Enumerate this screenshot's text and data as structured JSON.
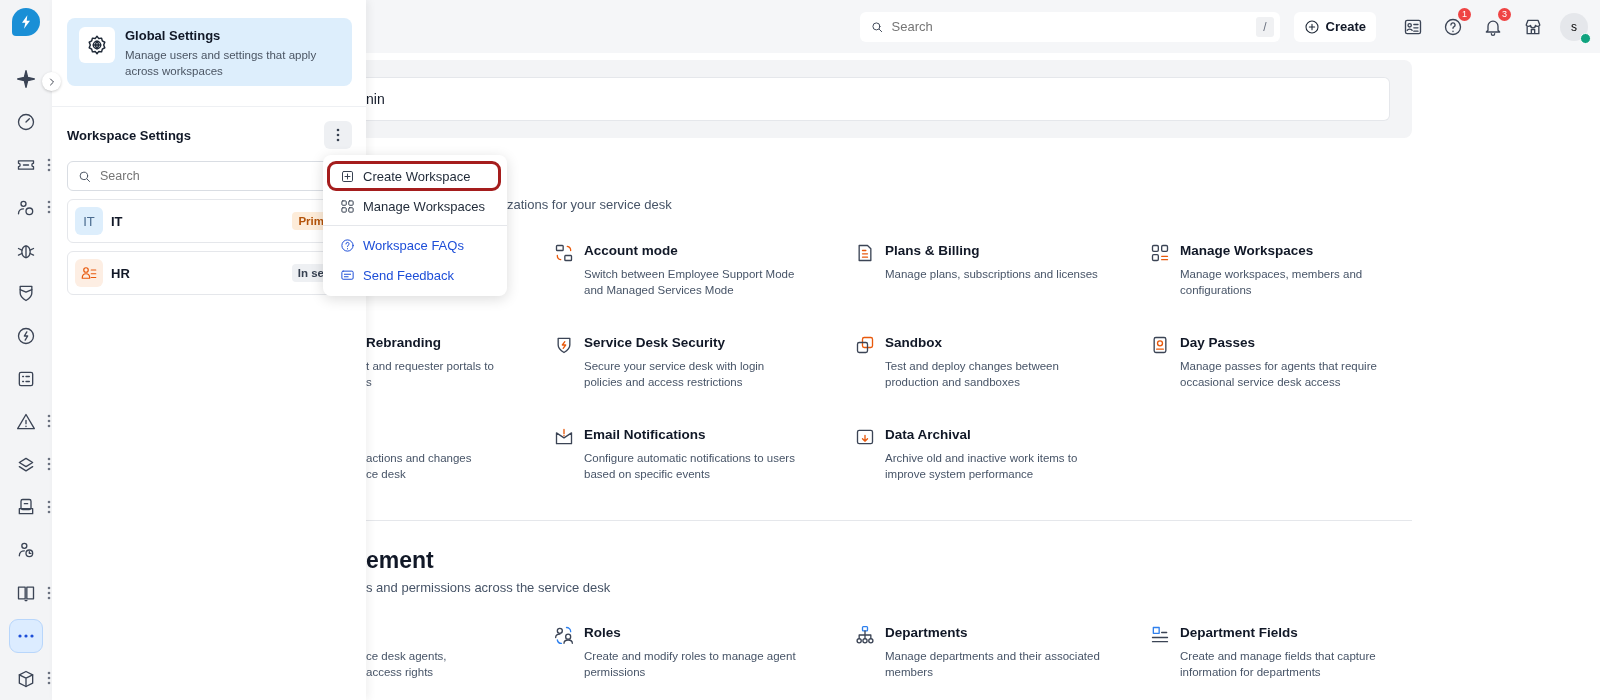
{
  "rail": {
    "items": [
      {
        "selected": false,
        "has_menu": false
      },
      {
        "selected": false,
        "has_menu": false
      },
      {
        "selected": false,
        "has_menu": true
      },
      {
        "selected": false,
        "has_menu": true
      },
      {
        "selected": false,
        "has_menu": false
      },
      {
        "selected": false,
        "has_menu": false
      },
      {
        "selected": false,
        "has_menu": false
      },
      {
        "selected": false,
        "has_menu": false
      },
      {
        "selected": false,
        "has_menu": true
      },
      {
        "selected": false,
        "has_menu": true
      },
      {
        "selected": false,
        "has_menu": true
      },
      {
        "selected": false,
        "has_menu": false
      },
      {
        "selected": false,
        "has_menu": true
      },
      {
        "selected": true,
        "has_menu": false
      },
      {
        "selected": false,
        "has_menu": true
      }
    ]
  },
  "panel": {
    "global": {
      "title": "Global Settings",
      "description": "Manage users and settings that apply across workspaces"
    },
    "workspace_title": "Workspace Settings",
    "search": {
      "placeholder": "Search"
    },
    "workspaces": [
      {
        "initials": "IT",
        "name": "IT",
        "badge": "Prim",
        "kind": "primary"
      },
      {
        "name": "HR",
        "badge": "In se",
        "kind": "setup"
      }
    ]
  },
  "menu": {
    "items": [
      {
        "label": "Create Workspace",
        "kind": "action",
        "highlighted": true
      },
      {
        "label": "Manage Workspaces",
        "kind": "action",
        "highlighted": false
      },
      {
        "label": "Workspace FAQs",
        "kind": "link",
        "highlighted": false
      },
      {
        "label": "Send Feedback",
        "kind": "link",
        "highlighted": false
      }
    ]
  },
  "header": {
    "search": {
      "placeholder": "Search",
      "shortcut": "/"
    },
    "create": "Create",
    "help_count": "1",
    "notification_count": "3",
    "avatar": "s",
    "online": true
  },
  "admin_search": {
    "value": "nin"
  },
  "sections": [
    {
      "subtitle": "zations for your service desk",
      "cards": [
        {
          "title": "Account mode",
          "lines": [
            "Switch between Employee Support Mode",
            "and Managed Services Mode"
          ]
        },
        {
          "title": "Plans & Billing",
          "lines": [
            "Manage plans, subscriptions and licenses"
          ]
        },
        {
          "title": "Manage Workspaces",
          "lines": [
            "Manage workspaces, members and",
            "configurations"
          ]
        },
        {
          "title": "Rebranding",
          "lines": [
            "t and requester portals to",
            "s"
          ]
        },
        {
          "title": "Service Desk Security",
          "lines": [
            "Secure your service desk with login",
            "policies and access restrictions"
          ]
        },
        {
          "title": "Sandbox",
          "lines": [
            "Test and deploy changes between",
            "production and sandboxes"
          ]
        },
        {
          "title": "Day Passes",
          "lines": [
            "Manage passes for agents that require",
            "occasional service desk access"
          ]
        },
        {
          "lines": [
            "actions and changes",
            "ce desk"
          ]
        },
        {
          "title": "Email Notifications",
          "lines": [
            "Configure automatic notifications to users",
            "based on specific events"
          ]
        },
        {
          "title": "Data Archival",
          "lines": [
            "Archive old and inactive work items to",
            "improve system performance"
          ]
        }
      ]
    },
    {
      "title": "ement",
      "subtitle": "s and permissions across the service desk",
      "cards": [
        {
          "lines": [
            "ce desk agents,",
            "access rights"
          ]
        },
        {
          "title": "Roles",
          "lines": [
            "Create and modify roles to manage agent",
            "permissions"
          ]
        },
        {
          "title": "Departments",
          "lines": [
            "Manage departments and their associated",
            "members"
          ]
        },
        {
          "title": "Department Fields",
          "lines": [
            "Create and manage fields that capture",
            "information for departments"
          ]
        }
      ]
    }
  ]
}
